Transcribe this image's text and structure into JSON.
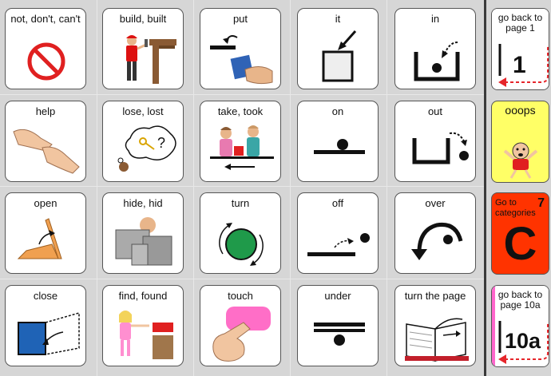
{
  "rows": [
    [
      {
        "name": "not",
        "label": "not, don't, can't",
        "icon": "prohibited-icon"
      },
      {
        "name": "build",
        "label": "build, built",
        "icon": "builder-icon"
      },
      {
        "name": "put",
        "label": "put",
        "icon": "put-box-icon"
      },
      {
        "name": "it",
        "label": "it",
        "icon": "arrow-to-square-icon"
      },
      {
        "name": "in",
        "label": "in",
        "icon": "in-container-icon"
      }
    ],
    [
      {
        "name": "help",
        "label": "help",
        "icon": "helping-hands-icon"
      },
      {
        "name": "lose",
        "label": "lose, lost",
        "icon": "lost-keys-icon"
      },
      {
        "name": "take",
        "label": "take, took",
        "icon": "take-gift-icon"
      },
      {
        "name": "on",
        "label": "on",
        "icon": "dot-on-line-icon"
      },
      {
        "name": "out",
        "label": "out",
        "icon": "out-container-icon"
      }
    ],
    [
      {
        "name": "open",
        "label": "open",
        "icon": "open-lid-icon"
      },
      {
        "name": "hide",
        "label": "hide,  hid",
        "icon": "hiding-person-icon"
      },
      {
        "name": "turn",
        "label": "turn",
        "icon": "turn-circle-icon"
      },
      {
        "name": "off",
        "label": "off",
        "icon": "off-line-icon"
      },
      {
        "name": "over",
        "label": "over",
        "icon": "arc-over-icon"
      }
    ],
    [
      {
        "name": "close",
        "label": "close",
        "icon": "close-door-icon"
      },
      {
        "name": "find",
        "label": "find,  found",
        "icon": "finding-girl-icon"
      },
      {
        "name": "touch",
        "label": "touch",
        "icon": "finger-touch-icon"
      },
      {
        "name": "under",
        "label": "under",
        "icon": "dot-under-line-icon"
      },
      {
        "name": "turn-page",
        "label": "turn the page",
        "icon": "book-page-icon"
      }
    ]
  ],
  "sidebar": [
    {
      "name": "go-back-page-1",
      "label": "go back to page 1",
      "page": "1",
      "icon": "back-arrow-icon",
      "bg": "#ffffff"
    },
    {
      "name": "ooops",
      "label": "ooops",
      "icon": "ooops-face-icon",
      "bg": "#ffff66"
    },
    {
      "name": "go-to-categories",
      "label": "Go to categories",
      "number": "7",
      "letter": "C",
      "icon": "categories-icon",
      "bg": "#ff3300"
    },
    {
      "name": "go-back-page-10a",
      "label": "go back to page 10a",
      "page": "10a",
      "icon": "back-arrow-icon",
      "bg": "#ffffff"
    }
  ],
  "colors": {
    "background": "#d6d6d6",
    "prohibit": "#e02020",
    "accent": "#e6262b",
    "categories": "#ff3300"
  }
}
